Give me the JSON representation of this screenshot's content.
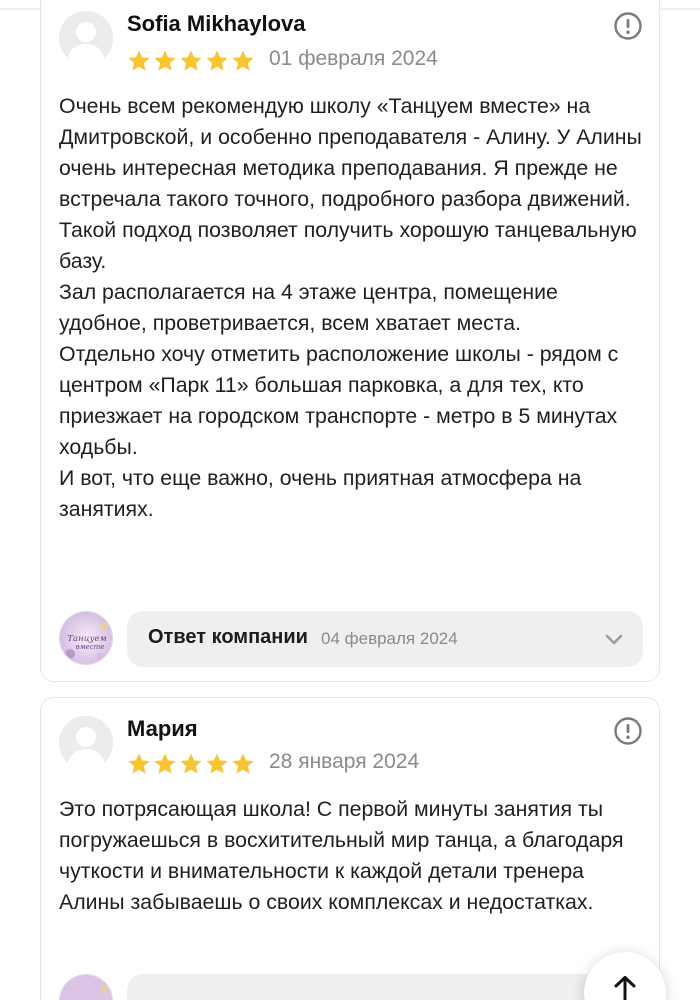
{
  "reviews": [
    {
      "author": "Sofia Mikhaylova",
      "rating": 5,
      "date": "01 февраля 2024",
      "text": "Очень всем рекомендую школу «Танцуем вместе» на Дмитровской, и особенно преподавателя - Алину. У Алины очень интересная методика преподавания. Я прежде не встречала такого точного, подробного разбора движений. Такой подход позволяет получить хорошую танцевальную базу.\nЗал располагается на 4 этаже центра, помещение удобное, проветривается, всем хватает места.\nОтдельно хочу отметить расположение школы - рядом с центром «Парк 11» большая парковка, а для тех, кто приезжает на городском транспорте - метро в 5 минутах ходьбы.\nИ вот, что еще важно, очень приятная атмосфера на занятиях.",
      "reply": {
        "label": "Ответ компании",
        "date": "04 февраля 2024"
      }
    },
    {
      "author": "Мария",
      "rating": 5,
      "date": "28 января 2024",
      "text": "Это потрясающая школа! С первой минуты занятия ты погружаешься в восхитительный мир танца, а благодаря чуткости и внимательности к каждой детали тренера Алины забываешь о своих комплексах и недостатках."
    }
  ],
  "company_logo": {
    "line1": "Танцуем",
    "line2": "вместе"
  },
  "icons": {
    "star": "star-icon",
    "report": "exclamation-circle-icon",
    "chevron": "chevron-down-icon",
    "scroll_top": "arrow-up-icon"
  },
  "colors": {
    "star": "#f7c531",
    "card_border": "#e6e6e6",
    "reply_bg": "#efefef",
    "muted": "#8a8a8a"
  }
}
